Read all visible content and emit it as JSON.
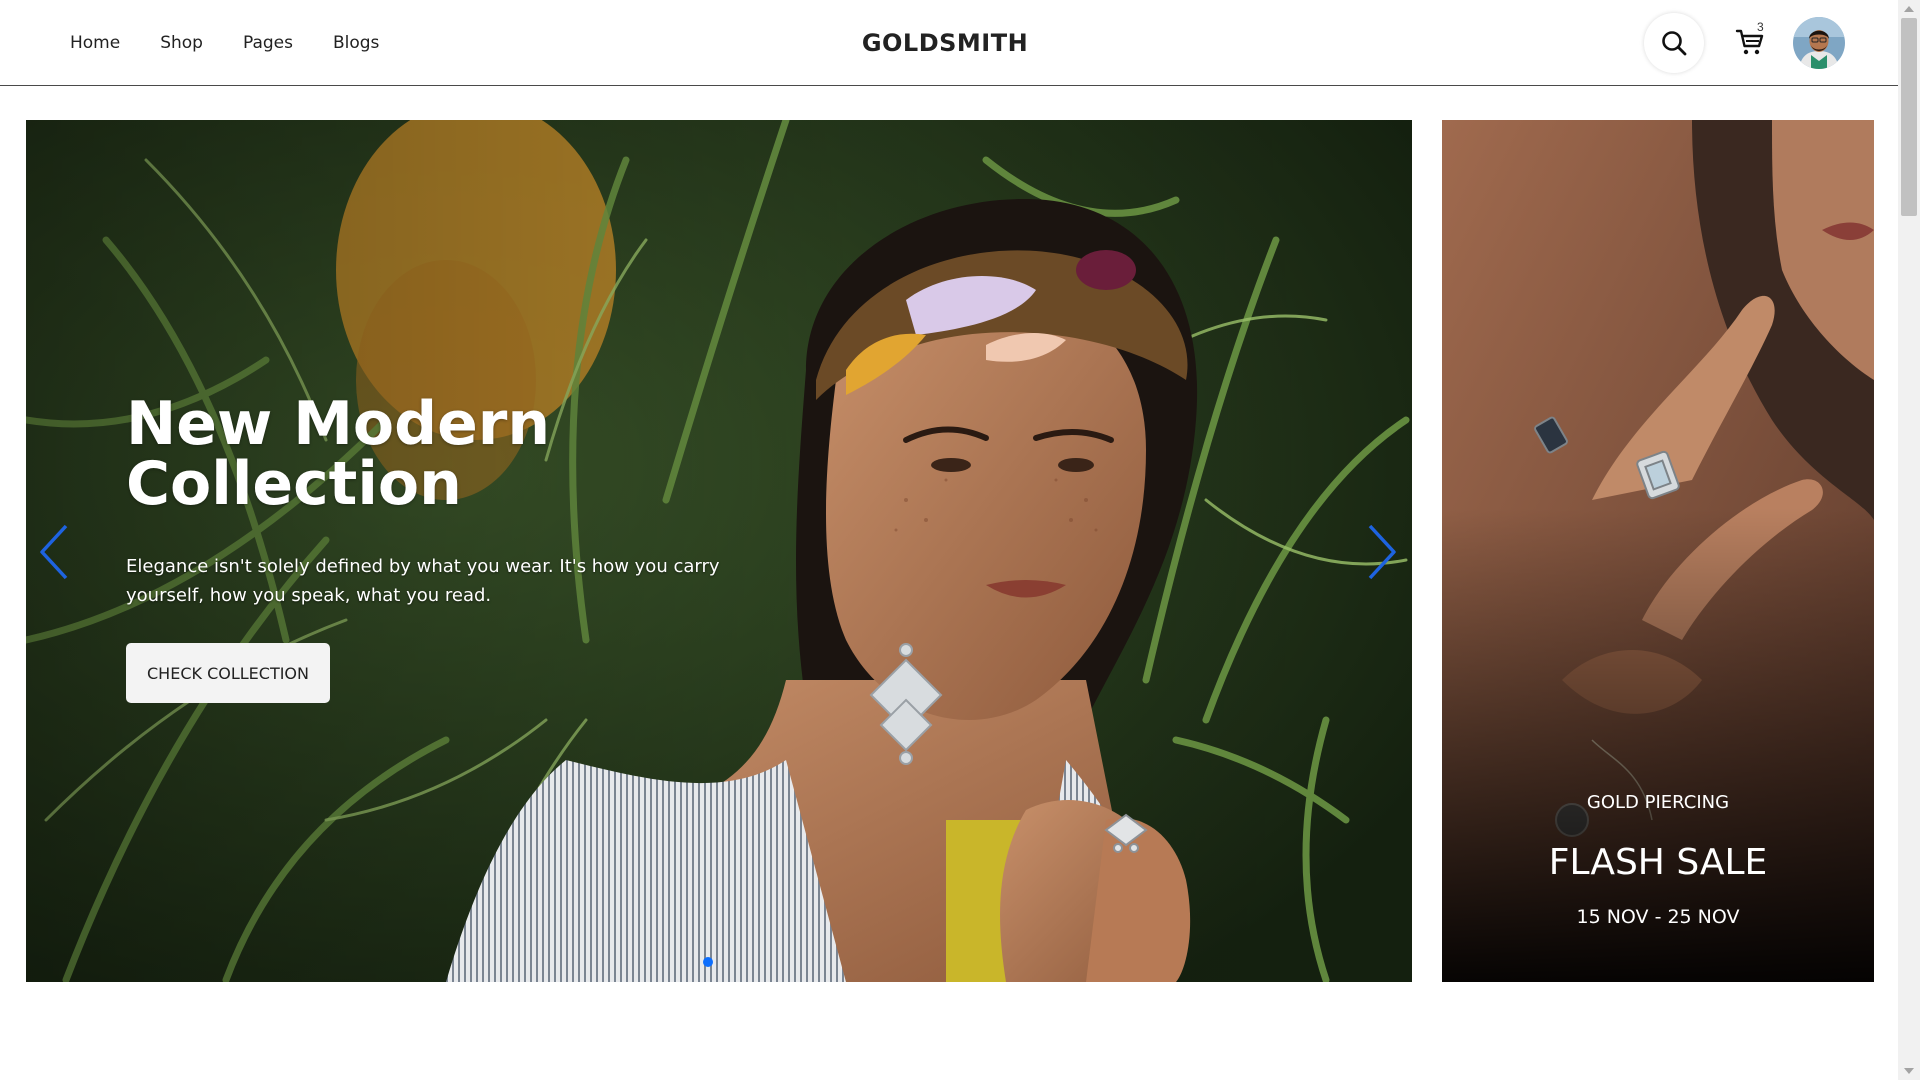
{
  "nav": {
    "items": [
      {
        "label": "Home"
      },
      {
        "label": "Shop"
      },
      {
        "label": "Pages"
      },
      {
        "label": "Blogs"
      }
    ]
  },
  "brand": {
    "name": "GOLDSMITH"
  },
  "header": {
    "search_icon": "search-icon",
    "cart_icon": "cart-icon",
    "cart_count": "3"
  },
  "hero": {
    "title": "New Modern Collection",
    "description": "Elegance isn't solely defined by what you wear. It's how you carry yourself, how you speak, what you read.",
    "cta_label": "CHECK COLLECTION",
    "prev_icon": "chevron-left-icon",
    "next_icon": "chevron-right-icon",
    "slide_count": 1,
    "active_slide": 1
  },
  "promo": {
    "kicker": "GOLD PIERCING",
    "title": "FLASH SALE",
    "dates": "15 NOV - 25 NOV"
  },
  "colors": {
    "accent": "#0d6efd",
    "header_border": "#4a4a4a",
    "text_dark": "#222222",
    "button_bg": "#f3f3f3"
  }
}
